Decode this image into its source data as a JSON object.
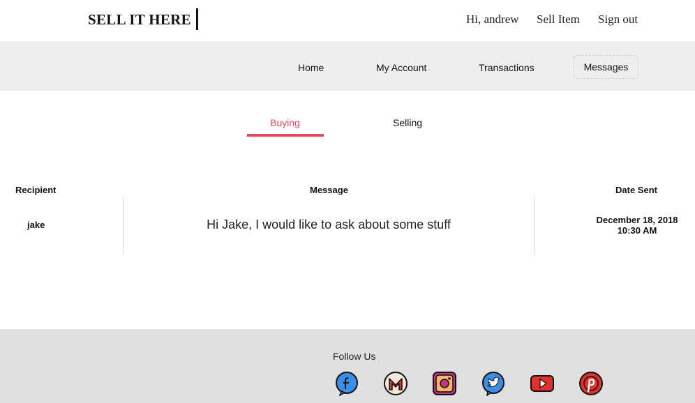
{
  "header": {
    "brand": "SELL IT HERE",
    "greeting": "Hi, andrew",
    "sell_item": "Sell Item",
    "sign_out": "Sign out"
  },
  "nav": {
    "items": [
      {
        "label": "Home"
      },
      {
        "label": "My Account"
      },
      {
        "label": "Transactions"
      },
      {
        "label": "Messages"
      }
    ]
  },
  "tabs": {
    "items": [
      {
        "label": "Buying"
      },
      {
        "label": "Selling"
      }
    ],
    "active_color": "#e8475f"
  },
  "table": {
    "columns": [
      "Recipient",
      "Message",
      "Date Sent"
    ],
    "rows": [
      {
        "recipient": "jake",
        "message": "Hi Jake, I would like to ask about some stuff",
        "date": "December 18, 2018",
        "time": "10:30 AM"
      }
    ]
  },
  "footer": {
    "follow_us": "Follow Us",
    "social_icons": [
      "facebook-icon",
      "gmail-icon",
      "instagram-icon",
      "twitter-icon",
      "youtube-icon",
      "pinterest-icon"
    ]
  }
}
